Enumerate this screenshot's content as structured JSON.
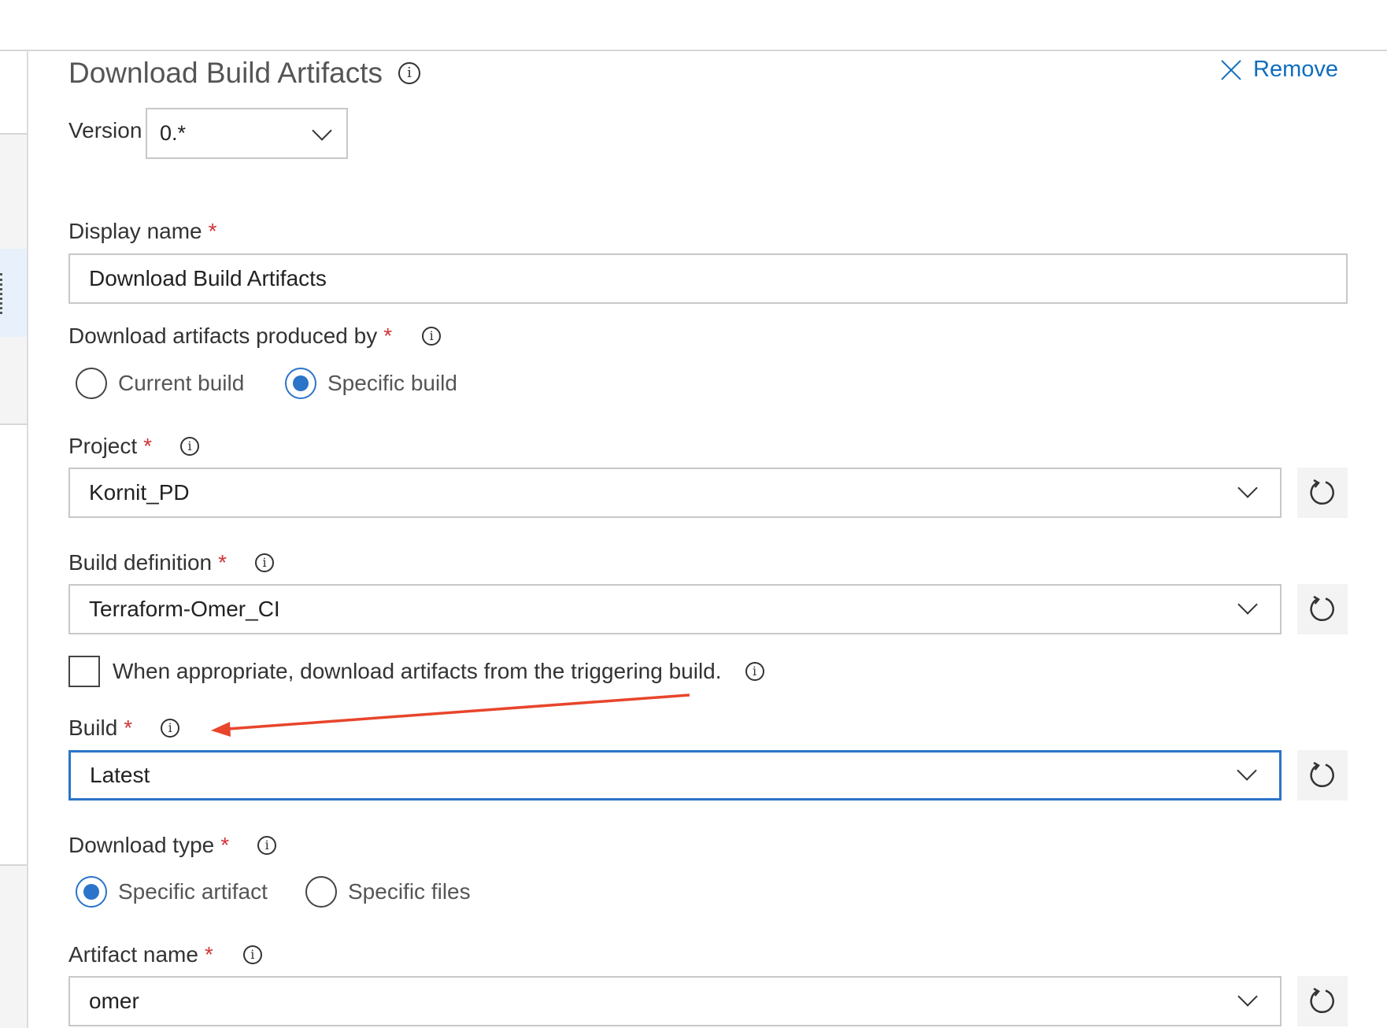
{
  "panel": {
    "title": "Download Build Artifacts",
    "remove_label": "Remove"
  },
  "version": {
    "label": "Version",
    "value": "0.*"
  },
  "display_name": {
    "label": "Display name",
    "value": "Download Build Artifacts"
  },
  "produced_by": {
    "label": "Download artifacts produced by",
    "options": [
      "Current build",
      "Specific build"
    ],
    "selected": "Specific build"
  },
  "project": {
    "label": "Project",
    "value": "Kornit_PD"
  },
  "build_definition": {
    "label": "Build definition",
    "value": "Terraform-Omer_CI"
  },
  "triggering_checkbox": {
    "label": "When appropriate, download artifacts from the triggering build.",
    "checked": false
  },
  "build": {
    "label": "Build",
    "value": "Latest"
  },
  "download_type": {
    "label": "Download type",
    "options": [
      "Specific artifact",
      "Specific files"
    ],
    "selected": "Specific artifact"
  },
  "artifact_name": {
    "label": "Artifact name",
    "value": "omer"
  },
  "required_marker": "*",
  "info_glyph": "i",
  "colors": {
    "accent": "#2b74c9",
    "link": "#106ebe",
    "required": "#d13438",
    "annotation_arrow": "#e8452c"
  }
}
